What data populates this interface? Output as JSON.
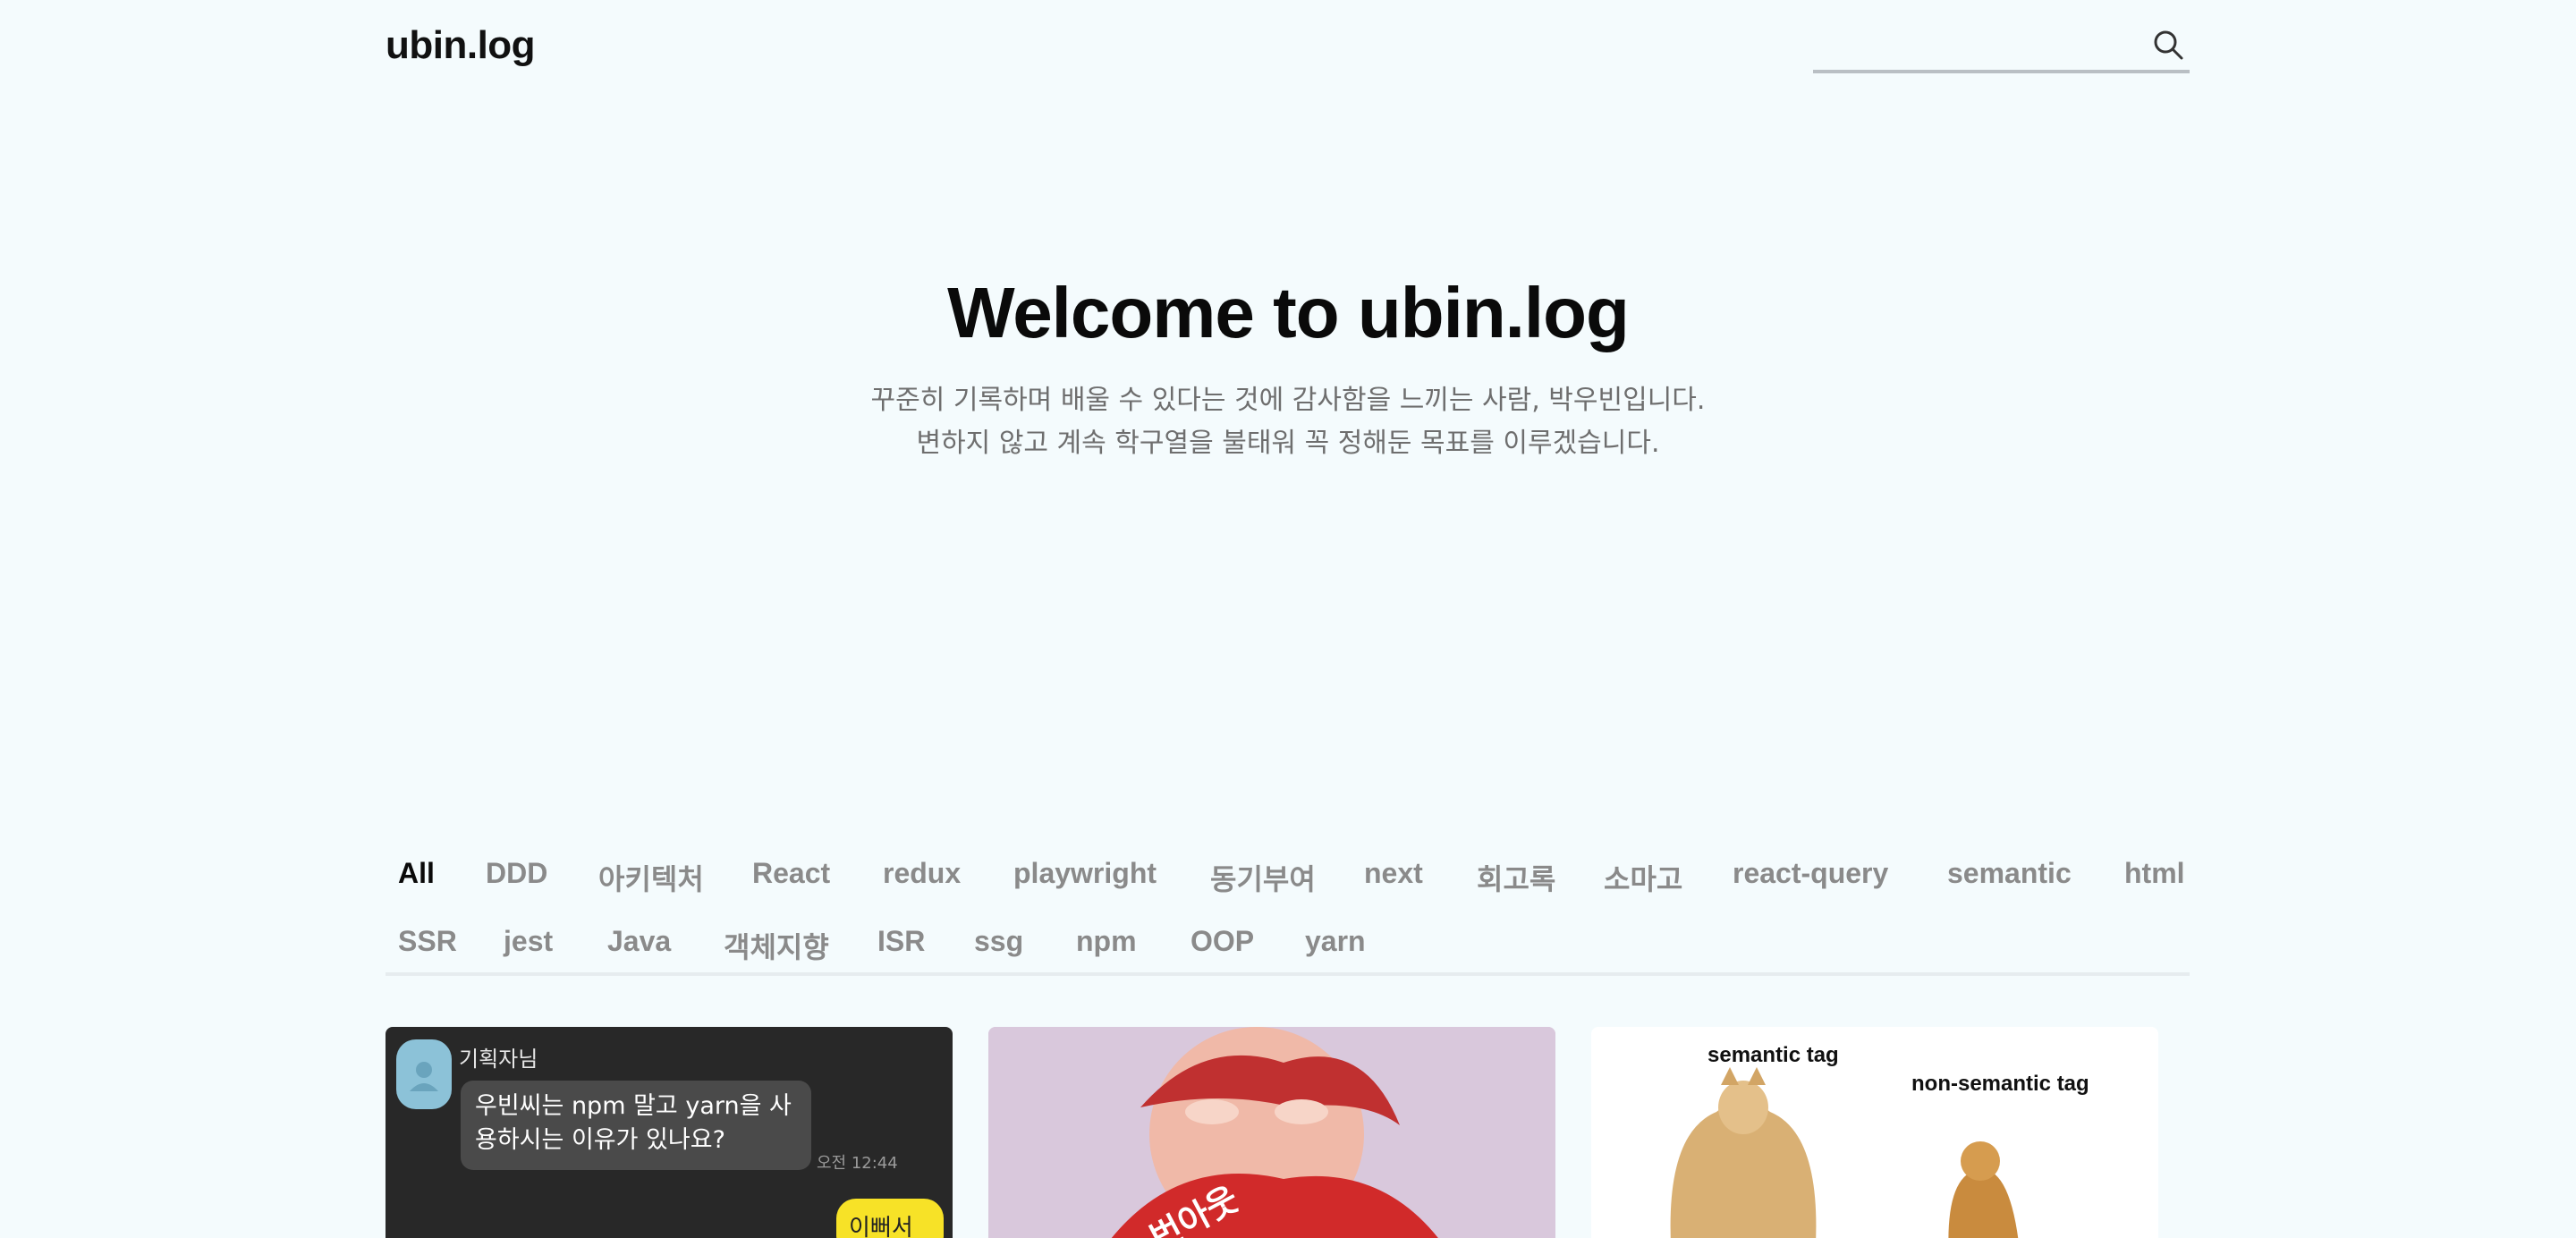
{
  "header": {
    "logo": "ubin.log",
    "search": {
      "placeholder": "",
      "value": ""
    }
  },
  "hero": {
    "title": "Welcome to ubin.log",
    "subtitle_line1": "꾸준히 기록하며 배울 수 있다는 것에 감사함을 느끼는 사람, 박우빈입니다.",
    "subtitle_line2": "변하지 않고 계속 학구열을 불태워 꼭 정해둔 목표를 이루겠습니다."
  },
  "tags": {
    "active": "All",
    "row1": [
      "All",
      "DDD",
      "아키텍처",
      "React",
      "redux",
      "playwright",
      "동기부여",
      "next",
      "회고록",
      "소마고",
      "react-query",
      "semantic",
      "html"
    ],
    "row2": [
      "SSR",
      "jest",
      "Java",
      "객체지향",
      "ISR",
      "ssg",
      "npm",
      "OOP",
      "yarn"
    ]
  },
  "cards": [
    {
      "chat_name": "기획자님",
      "message": "우빈씨는 npm 말고 yarn을 사용하시는 이유가 있나요?",
      "time": "오전 12:44",
      "reply": "이뻐서요"
    },
    {
      "image_text": "번아웃"
    },
    {
      "label_left": "semantic tag",
      "label_right": "non-semantic tag"
    }
  ],
  "colors": {
    "background": "#f4fbfd",
    "tag_inactive": "#8a8a8a",
    "tag_active": "#0a0a0a",
    "chat_bg": "#282828",
    "reply_bubble": "#f7e227"
  }
}
